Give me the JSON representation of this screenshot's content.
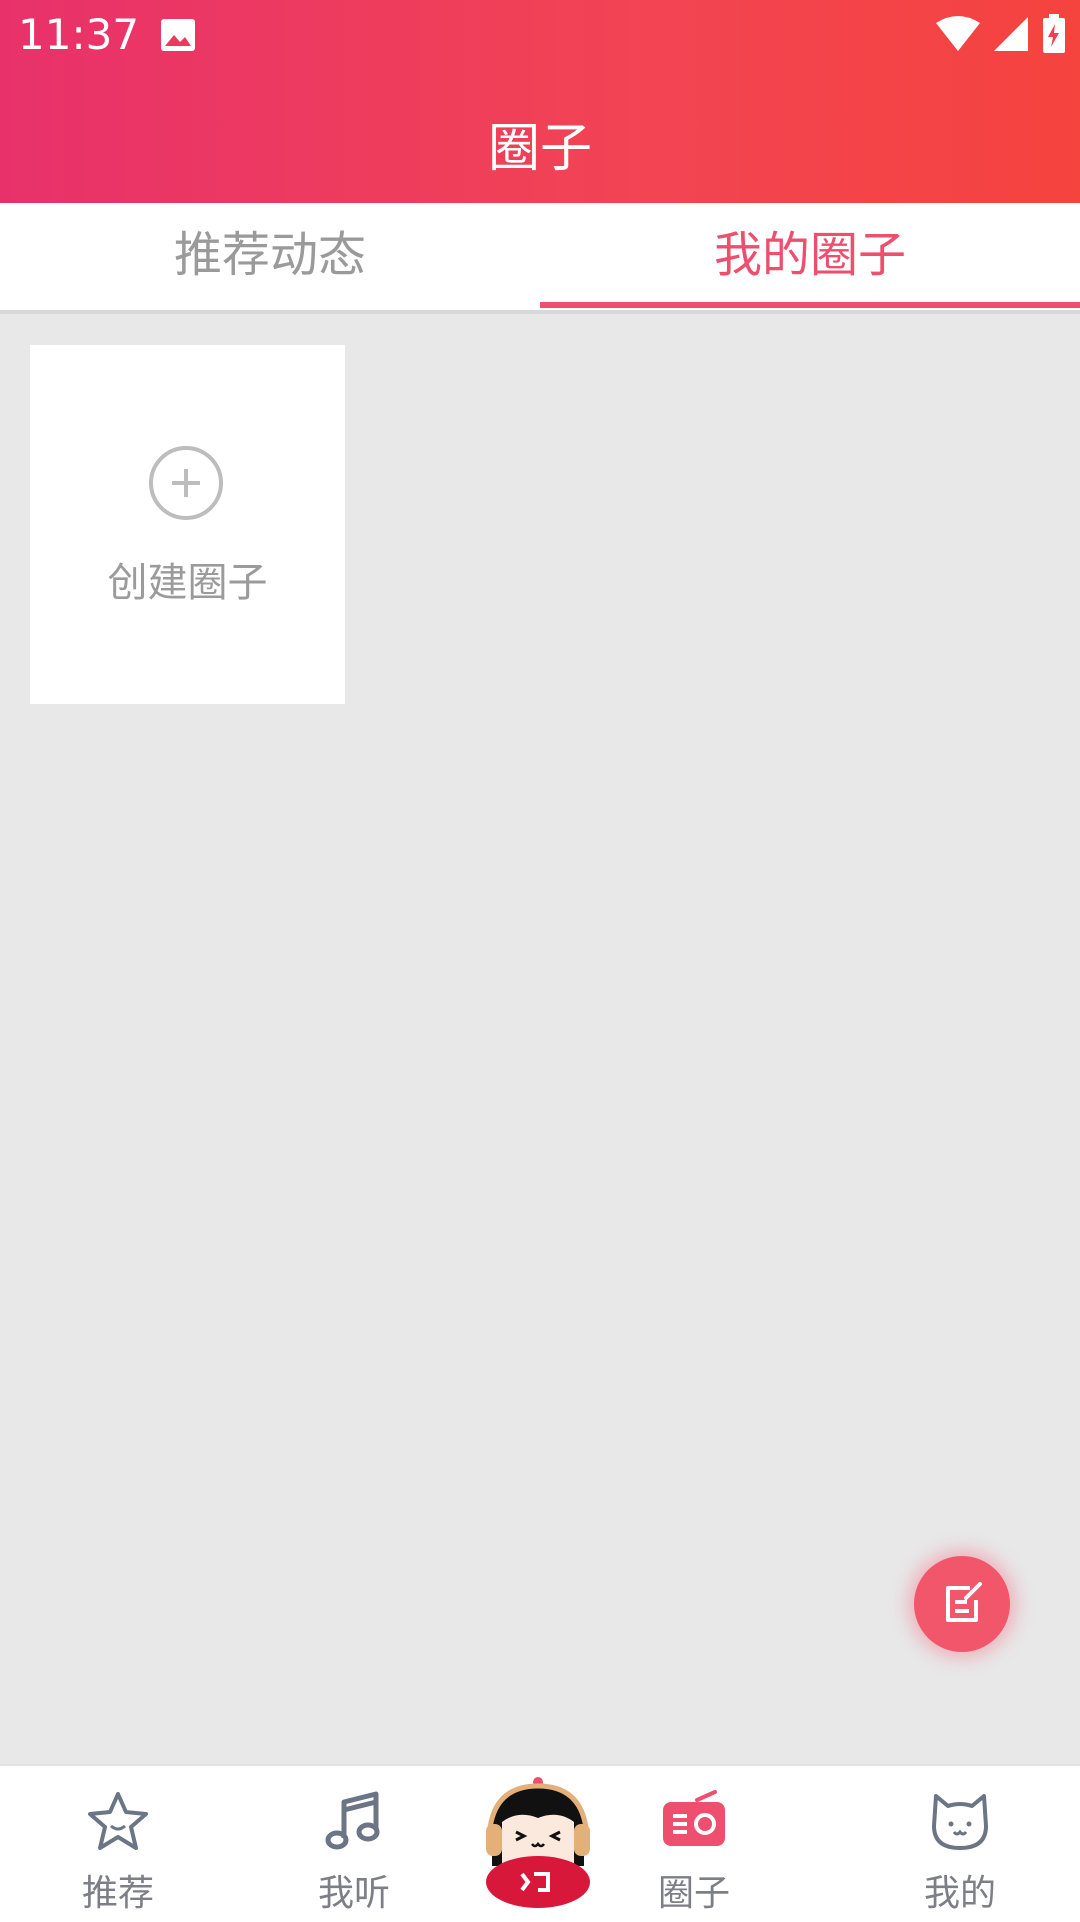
{
  "status": {
    "time": "11:37"
  },
  "header": {
    "title": "圈子"
  },
  "tabs": [
    {
      "label": "推荐动态",
      "active": false
    },
    {
      "label": "我的圈子",
      "active": true
    }
  ],
  "create_card": {
    "label": "创建圈子",
    "icon": "plus-circle-icon"
  },
  "fab": {
    "icon": "edit-note-icon"
  },
  "bottom_nav": {
    "items": [
      {
        "label": "推荐",
        "icon": "star-face-icon",
        "active": false
      },
      {
        "label": "我听",
        "icon": "music-note-icon",
        "active": false
      },
      {
        "label": "",
        "icon": "mascot-avatar-icon",
        "active": false
      },
      {
        "label": "圈子",
        "icon": "radio-icon",
        "active": true
      },
      {
        "label": "我的",
        "icon": "cat-face-icon",
        "active": false
      }
    ]
  },
  "colors": {
    "accent": "#ef4f6f",
    "header_start": "#e8316b",
    "header_end": "#f5433e",
    "background": "#e8e8e9"
  }
}
